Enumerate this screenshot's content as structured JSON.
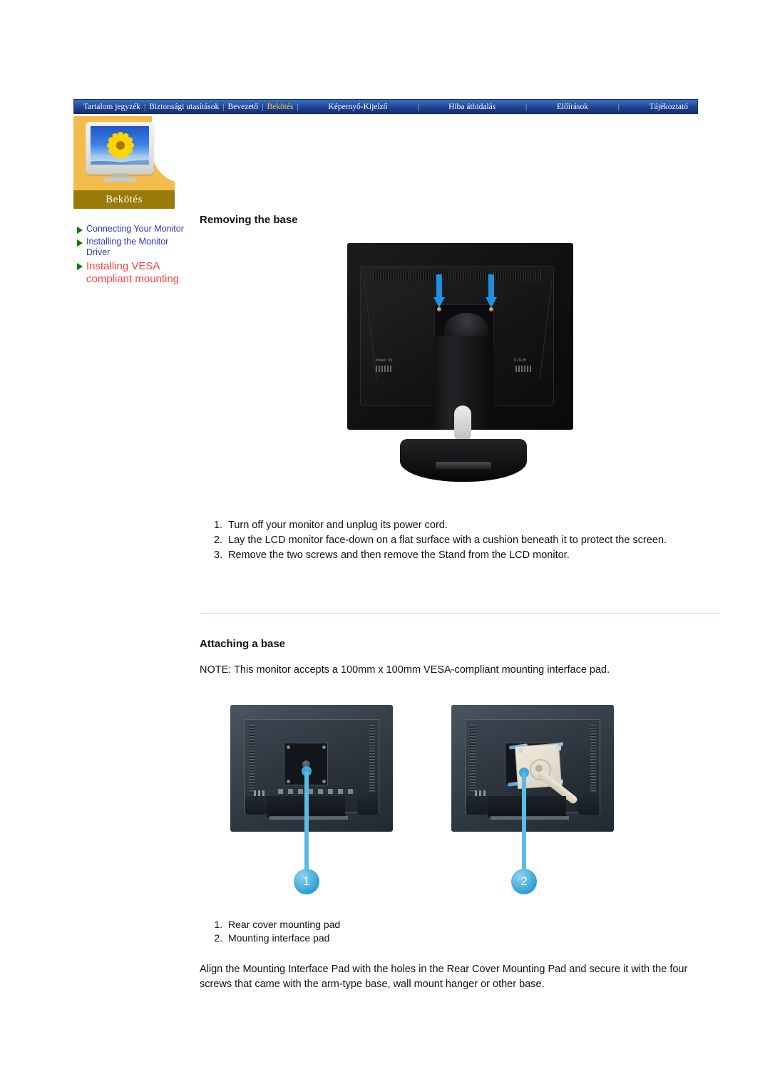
{
  "nav": {
    "items": [
      {
        "label": "Tartalom jegyzék",
        "active": false
      },
      {
        "label": "Biztonsági utasítások",
        "active": false
      },
      {
        "label": "Bevezető",
        "active": false
      },
      {
        "label": "Bekötés",
        "active": true
      },
      {
        "label": "Képernyő-Kijelző",
        "active": false
      },
      {
        "label": "Hiba áthidalás",
        "active": false
      },
      {
        "label": "Előírások",
        "active": false
      },
      {
        "label": "Tájékoztató",
        "active": false
      }
    ],
    "separator": "|",
    "active_color": "#ffcc33",
    "background_color": "#1d3f8f"
  },
  "header": {
    "banner_label": "Bekötés",
    "banner_color": "#9a7a09",
    "panel_color": "#f3bc4d",
    "thumbnail_icon": "monitor-with-sunflower-image"
  },
  "sidebar": {
    "items": [
      {
        "label": "Connecting Your Monitor",
        "active": false
      },
      {
        "label": "Installing the Monitor Driver",
        "active": false
      },
      {
        "label": "Installing VESA compliant mounting",
        "active": true
      }
    ],
    "bullet_icon": "green-triangle-bullet-icon",
    "link_color": "#2e35c8",
    "active_link_color": "#fb4141"
  },
  "main": {
    "section1": {
      "title": "Removing the base",
      "figure_caption": "monitor-rear-with-stand-and-two-blue-arrows",
      "steps": [
        "Turn off your monitor and unplug its power cord.",
        "Lay the LCD monitor face-down on a flat surface with a cushion beneath it to protect the screen.",
        "Remove the two screws and then remove the Stand from the LCD monitor."
      ]
    },
    "section2": {
      "title": "Attaching a base",
      "note": "NOTE: This monitor accepts a 100mm x 100mm VESA-compliant mounting interface pad.",
      "figures": [
        {
          "callout": "1",
          "caption": "monitor-rear-cover-mounting-pad"
        },
        {
          "callout": "2",
          "caption": "monitor-with-mounting-interface-pad"
        }
      ],
      "legend": [
        "Rear cover mounting pad",
        "Mounting interface pad"
      ],
      "paragraph": "Align the Mounting Interface Pad with the holes in the Rear Cover Mounting Pad and secure it with the four screws that came with the arm-type base, wall mount hanger or other base."
    }
  }
}
